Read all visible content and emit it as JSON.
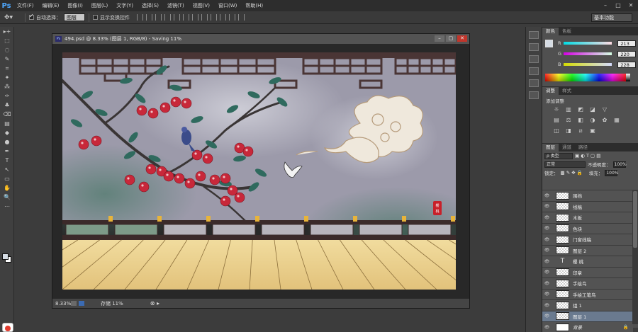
{
  "app": {
    "logo": "Ps",
    "menu": [
      "文件(F)",
      "编辑(E)",
      "图像(I)",
      "图层(L)",
      "文字(Y)",
      "选择(S)",
      "滤镜(T)",
      "视图(V)",
      "窗口(W)",
      "帮助(H)"
    ],
    "window_controls": [
      "–",
      "□",
      "✕"
    ]
  },
  "options": {
    "auto_select_label": "自动选择：",
    "auto_select_value": "图层",
    "show_transform_label": "显示变换控件",
    "workspace": "基本功能"
  },
  "tools": [
    "▸+",
    "⬚",
    "◌",
    "✎",
    "⌗",
    "✦",
    "⁂",
    "✑",
    "♣",
    "⌫",
    "▤",
    "◆",
    "●",
    "✒",
    "T",
    "↖",
    "▭",
    "✋",
    "🔍",
    "⋯"
  ],
  "document": {
    "title": "494.psd @ 8.33% (图层 1, RGB/8) - Saving 11%",
    "zoom": "8.33%",
    "save_status": "存储 11%",
    "controls": [
      "–",
      "▢",
      "✕"
    ]
  },
  "color_panel": {
    "tabs": [
      "颜色",
      "色板"
    ],
    "channels": [
      {
        "label": "R",
        "value": "213"
      },
      {
        "label": "G",
        "value": "220"
      },
      {
        "label": "B",
        "value": "228"
      }
    ],
    "foreground": "#d5dce4"
  },
  "adjust_panel": {
    "tabs": [
      "调整",
      "样式"
    ],
    "title": "添加调整",
    "icons": [
      "☼",
      "▥",
      "◩",
      "◪",
      "▽",
      "",
      "▤",
      "⚖",
      "◧",
      "◑",
      "✿",
      "▦",
      "◫",
      "◨",
      "⧄",
      "▣",
      "",
      ""
    ]
  },
  "layers_panel": {
    "tabs": [
      "图层",
      "通道",
      "路径"
    ],
    "filter_label": "ρ 类型",
    "blend_mode": "正常",
    "opacity_label": "不透明度：",
    "opacity_value": "100%",
    "lock_label": "锁定：",
    "fill_label": "填充：",
    "fill_value": "100%",
    "layers": [
      {
        "name": "围挡",
        "thumb": "checker"
      },
      {
        "name": "线稿",
        "thumb": "checker"
      },
      {
        "name": "木板",
        "thumb": "checker"
      },
      {
        "name": "色块",
        "thumb": "checker"
      },
      {
        "name": "门窗线稿",
        "thumb": "checker"
      },
      {
        "name": "图层 2",
        "thumb": "checker"
      },
      {
        "name": "樱 桃",
        "thumb": "text"
      },
      {
        "name": "印章",
        "thumb": "checker"
      },
      {
        "name": "手绘鸟",
        "thumb": "checker"
      },
      {
        "name": "手绘工笔鸟",
        "thumb": "checker"
      },
      {
        "name": "组 1",
        "thumb": "checker"
      },
      {
        "name": "图层 1",
        "thumb": "checker",
        "selected": true
      },
      {
        "name": "背景",
        "thumb": "white",
        "italic": true,
        "locked": true
      }
    ]
  },
  "artwork": {
    "seal_text": "樱桃",
    "colors": {
      "wall": "#9a98a8",
      "lattice": "#4a3535",
      "floor": "#e9cf8f",
      "cherry": "#c8283a",
      "leaf": "#2f6a5e",
      "railing": "#3b2a2a"
    }
  }
}
